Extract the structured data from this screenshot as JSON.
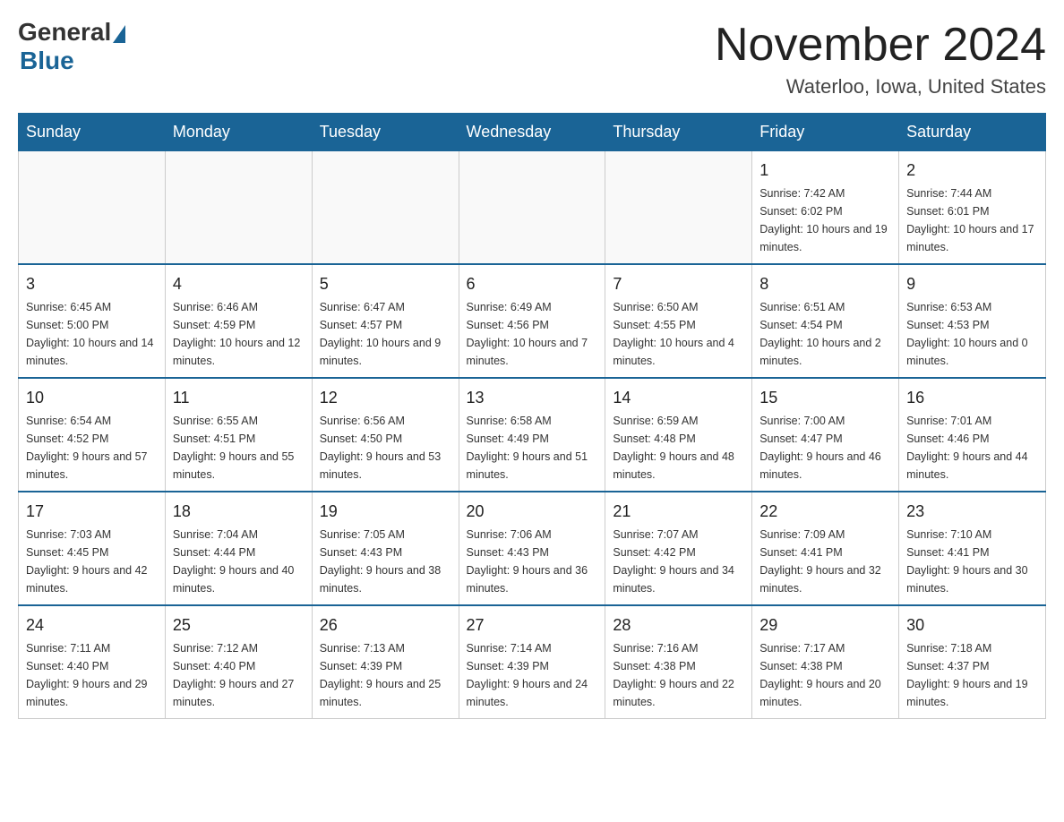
{
  "header": {
    "logo_general": "General",
    "logo_blue": "Blue",
    "title": "November 2024",
    "subtitle": "Waterloo, Iowa, United States"
  },
  "weekdays": [
    "Sunday",
    "Monday",
    "Tuesday",
    "Wednesday",
    "Thursday",
    "Friday",
    "Saturday"
  ],
  "weeks": [
    [
      {
        "day": "",
        "info": ""
      },
      {
        "day": "",
        "info": ""
      },
      {
        "day": "",
        "info": ""
      },
      {
        "day": "",
        "info": ""
      },
      {
        "day": "",
        "info": ""
      },
      {
        "day": "1",
        "info": "Sunrise: 7:42 AM\nSunset: 6:02 PM\nDaylight: 10 hours and 19 minutes."
      },
      {
        "day": "2",
        "info": "Sunrise: 7:44 AM\nSunset: 6:01 PM\nDaylight: 10 hours and 17 minutes."
      }
    ],
    [
      {
        "day": "3",
        "info": "Sunrise: 6:45 AM\nSunset: 5:00 PM\nDaylight: 10 hours and 14 minutes."
      },
      {
        "day": "4",
        "info": "Sunrise: 6:46 AM\nSunset: 4:59 PM\nDaylight: 10 hours and 12 minutes."
      },
      {
        "day": "5",
        "info": "Sunrise: 6:47 AM\nSunset: 4:57 PM\nDaylight: 10 hours and 9 minutes."
      },
      {
        "day": "6",
        "info": "Sunrise: 6:49 AM\nSunset: 4:56 PM\nDaylight: 10 hours and 7 minutes."
      },
      {
        "day": "7",
        "info": "Sunrise: 6:50 AM\nSunset: 4:55 PM\nDaylight: 10 hours and 4 minutes."
      },
      {
        "day": "8",
        "info": "Sunrise: 6:51 AM\nSunset: 4:54 PM\nDaylight: 10 hours and 2 minutes."
      },
      {
        "day": "9",
        "info": "Sunrise: 6:53 AM\nSunset: 4:53 PM\nDaylight: 10 hours and 0 minutes."
      }
    ],
    [
      {
        "day": "10",
        "info": "Sunrise: 6:54 AM\nSunset: 4:52 PM\nDaylight: 9 hours and 57 minutes."
      },
      {
        "day": "11",
        "info": "Sunrise: 6:55 AM\nSunset: 4:51 PM\nDaylight: 9 hours and 55 minutes."
      },
      {
        "day": "12",
        "info": "Sunrise: 6:56 AM\nSunset: 4:50 PM\nDaylight: 9 hours and 53 minutes."
      },
      {
        "day": "13",
        "info": "Sunrise: 6:58 AM\nSunset: 4:49 PM\nDaylight: 9 hours and 51 minutes."
      },
      {
        "day": "14",
        "info": "Sunrise: 6:59 AM\nSunset: 4:48 PM\nDaylight: 9 hours and 48 minutes."
      },
      {
        "day": "15",
        "info": "Sunrise: 7:00 AM\nSunset: 4:47 PM\nDaylight: 9 hours and 46 minutes."
      },
      {
        "day": "16",
        "info": "Sunrise: 7:01 AM\nSunset: 4:46 PM\nDaylight: 9 hours and 44 minutes."
      }
    ],
    [
      {
        "day": "17",
        "info": "Sunrise: 7:03 AM\nSunset: 4:45 PM\nDaylight: 9 hours and 42 minutes."
      },
      {
        "day": "18",
        "info": "Sunrise: 7:04 AM\nSunset: 4:44 PM\nDaylight: 9 hours and 40 minutes."
      },
      {
        "day": "19",
        "info": "Sunrise: 7:05 AM\nSunset: 4:43 PM\nDaylight: 9 hours and 38 minutes."
      },
      {
        "day": "20",
        "info": "Sunrise: 7:06 AM\nSunset: 4:43 PM\nDaylight: 9 hours and 36 minutes."
      },
      {
        "day": "21",
        "info": "Sunrise: 7:07 AM\nSunset: 4:42 PM\nDaylight: 9 hours and 34 minutes."
      },
      {
        "day": "22",
        "info": "Sunrise: 7:09 AM\nSunset: 4:41 PM\nDaylight: 9 hours and 32 minutes."
      },
      {
        "day": "23",
        "info": "Sunrise: 7:10 AM\nSunset: 4:41 PM\nDaylight: 9 hours and 30 minutes."
      }
    ],
    [
      {
        "day": "24",
        "info": "Sunrise: 7:11 AM\nSunset: 4:40 PM\nDaylight: 9 hours and 29 minutes."
      },
      {
        "day": "25",
        "info": "Sunrise: 7:12 AM\nSunset: 4:40 PM\nDaylight: 9 hours and 27 minutes."
      },
      {
        "day": "26",
        "info": "Sunrise: 7:13 AM\nSunset: 4:39 PM\nDaylight: 9 hours and 25 minutes."
      },
      {
        "day": "27",
        "info": "Sunrise: 7:14 AM\nSunset: 4:39 PM\nDaylight: 9 hours and 24 minutes."
      },
      {
        "day": "28",
        "info": "Sunrise: 7:16 AM\nSunset: 4:38 PM\nDaylight: 9 hours and 22 minutes."
      },
      {
        "day": "29",
        "info": "Sunrise: 7:17 AM\nSunset: 4:38 PM\nDaylight: 9 hours and 20 minutes."
      },
      {
        "day": "30",
        "info": "Sunrise: 7:18 AM\nSunset: 4:37 PM\nDaylight: 9 hours and 19 minutes."
      }
    ]
  ]
}
